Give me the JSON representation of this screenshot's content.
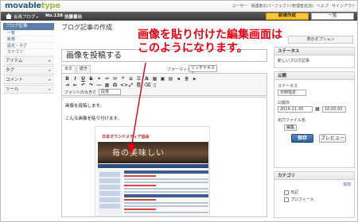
{
  "app": {
    "logo_main": "movable",
    "logo_accent": "type"
  },
  "top_links": [
    "ユーザー",
    "保護者のパーフェクト(管理者名前)",
    "ヘルプ",
    "サインアウト"
  ],
  "blog_bar": {
    "blog_selector": "会員ブログ",
    "entry_number": "No.138",
    "blog_name": "技藤書出",
    "new_button": "新規作成",
    "list_button": "一覧"
  },
  "left_nav": {
    "header": "ブログ記事",
    "items": [
      "一覧",
      "新規",
      "設定・タグ",
      "カテゴリ"
    ],
    "sections": [
      "アイテム",
      "タグ",
      "コメント",
      "ツール"
    ]
  },
  "main": {
    "page_title": "ブログ記事の作成",
    "title_value": "画像を投稿する",
    "tabs": [
      "本文",
      "続き"
    ],
    "format_label": "フォーマット",
    "format_value": "リッチテキスト",
    "font_label": "フォントの大きさ",
    "paragraph_value": "段落",
    "body_line1": "画像を投稿します。",
    "body_line2": "こんな画像を貼り付けます。"
  },
  "embedded_image": {
    "site_name": "日本オウンドメディア協会",
    "banner_text": "毎の美味しい"
  },
  "annotation": {
    "line1": "画像を貼り付けた編集画面は",
    "line2": "このようになります。",
    "color": "#e60012"
  },
  "right": {
    "display_options": "表示オプション",
    "status_box": {
      "header": "ステータス",
      "text": "新しいブログ記事"
    },
    "publish_box": {
      "header": "公開",
      "status_label": "ステータス",
      "status_value": "日時指定",
      "date_label": "公開日",
      "date_value": "2014-11-30",
      "time_value": "10:00:00",
      "output_label": "出力ファイル名",
      "edit_button": "編集",
      "save_button": "保存",
      "preview_button": "プレビュー"
    },
    "category_box": {
      "header": "カテゴリ",
      "add_link": "追加",
      "items": [
        "日記",
        "プロフィール"
      ]
    }
  }
}
